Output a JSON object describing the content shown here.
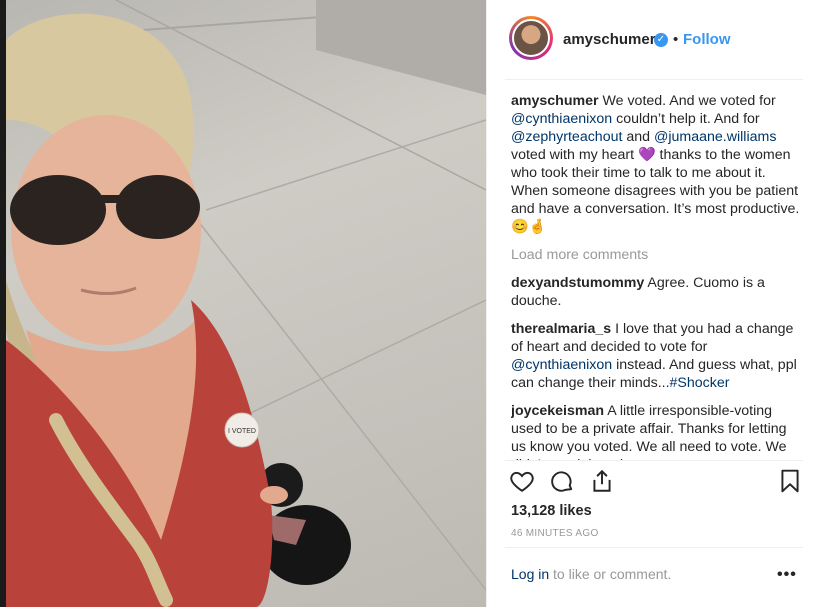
{
  "post": {
    "username": "amyschumer",
    "follow_label": "Follow",
    "caption_user": "amyschumer",
    "caption_parts": [
      {
        "t": "text",
        "v": " We voted. And we voted for "
      },
      {
        "t": "mention",
        "v": "@cynthiaenixon"
      },
      {
        "t": "text",
        "v": " couldn’t help it. And for "
      },
      {
        "t": "mention",
        "v": "@zephyrteachout"
      },
      {
        "t": "text",
        "v": " and "
      },
      {
        "t": "mention",
        "v": "@jumaane.williams"
      },
      {
        "t": "text",
        "v": " voted with my heart 💜 thanks to the women who took their time to talk to me about it. When someone disagrees with you be patient and have a conversation. It’s most productive. 😊🤞"
      }
    ],
    "load_more": "Load more comments",
    "comments": [
      {
        "user": "dexyandstumommy",
        "parts": [
          {
            "t": "text",
            "v": " Agree. Cuomo is a douche."
          }
        ]
      },
      {
        "user": "therealmaria_s",
        "parts": [
          {
            "t": "text",
            "v": " I love that you had a change of heart and decided to vote for "
          },
          {
            "t": "mention",
            "v": "@cynthiaenixon"
          },
          {
            "t": "text",
            "v": " instead. And guess what, ppl can change their minds..."
          },
          {
            "t": "mention",
            "v": "#Shocker"
          }
        ]
      },
      {
        "user": "joycekeisman",
        "parts": [
          {
            "t": "text",
            "v": " A little irresponsible-voting used to be a private affair. Thanks for letting us know you voted. We all need to vote. We didn’t need the other"
          }
        ]
      }
    ],
    "likes": "13,128 likes",
    "time": "46 MINUTES AGO",
    "login_link": "Log in",
    "login_rest": " to like or comment.",
    "more_label": "•••",
    "sticker_text": "I VOTED"
  },
  "icons": {
    "verified": "verified-badge-icon",
    "like": "heart-icon",
    "comment": "comment-bubble-icon",
    "share": "share-icon",
    "save": "bookmark-icon"
  },
  "colors": {
    "link": "#003569",
    "follow": "#3897f0",
    "muted": "#999999",
    "shirt": "#b9423b"
  }
}
